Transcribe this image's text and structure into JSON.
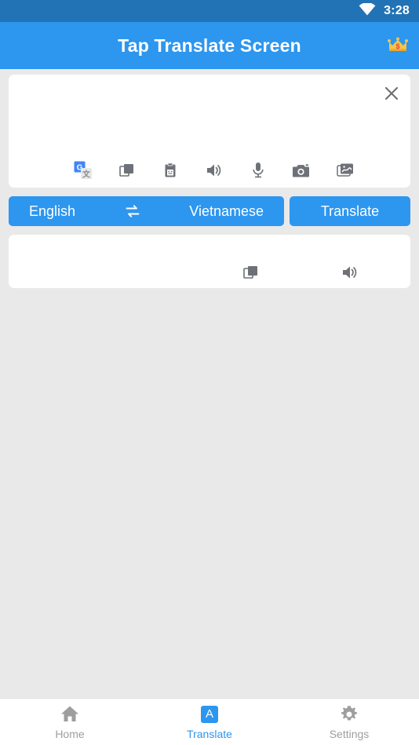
{
  "status_bar": {
    "time": "3:28",
    "wifi_icon": "wifi-icon",
    "background_color": "#2273B5"
  },
  "header": {
    "title": "Tap Translate Screen",
    "premium_icon": "crown-icon",
    "background_color": "#2D96EF",
    "text_color": "#FFFFFF"
  },
  "input_card": {
    "text": "",
    "placeholder": "",
    "close_icon": "close-icon",
    "actions": [
      {
        "name": "google-translate-icon",
        "label": "Google Translate"
      },
      {
        "name": "copy-icon",
        "label": "Copy"
      },
      {
        "name": "clipboard-paste-icon",
        "label": "Paste"
      },
      {
        "name": "speaker-icon",
        "label": "Speak"
      },
      {
        "name": "microphone-icon",
        "label": "Voice input"
      },
      {
        "name": "camera-icon",
        "label": "Camera"
      },
      {
        "name": "image-icon",
        "label": "Image"
      }
    ]
  },
  "language_bar": {
    "source_language": "English",
    "target_language": "Vietnamese",
    "swap_icon": "swap-icon",
    "translate_label": "Translate",
    "accent_color": "#2D96EF"
  },
  "output_card": {
    "text": "",
    "actions": [
      {
        "name": "copy-icon",
        "label": "Copy"
      },
      {
        "name": "speaker-icon",
        "label": "Speak"
      }
    ]
  },
  "bottom_nav": {
    "items": [
      {
        "label": "Home",
        "icon": "home-icon",
        "active": false
      },
      {
        "label": "Translate",
        "icon": "translate-badge-icon",
        "active": true
      },
      {
        "label": "Settings",
        "icon": "gear-icon",
        "active": false
      }
    ],
    "active_color": "#2D96EF",
    "inactive_color": "#9E9E9E"
  },
  "page": {
    "background_color": "#EAE9EA"
  }
}
